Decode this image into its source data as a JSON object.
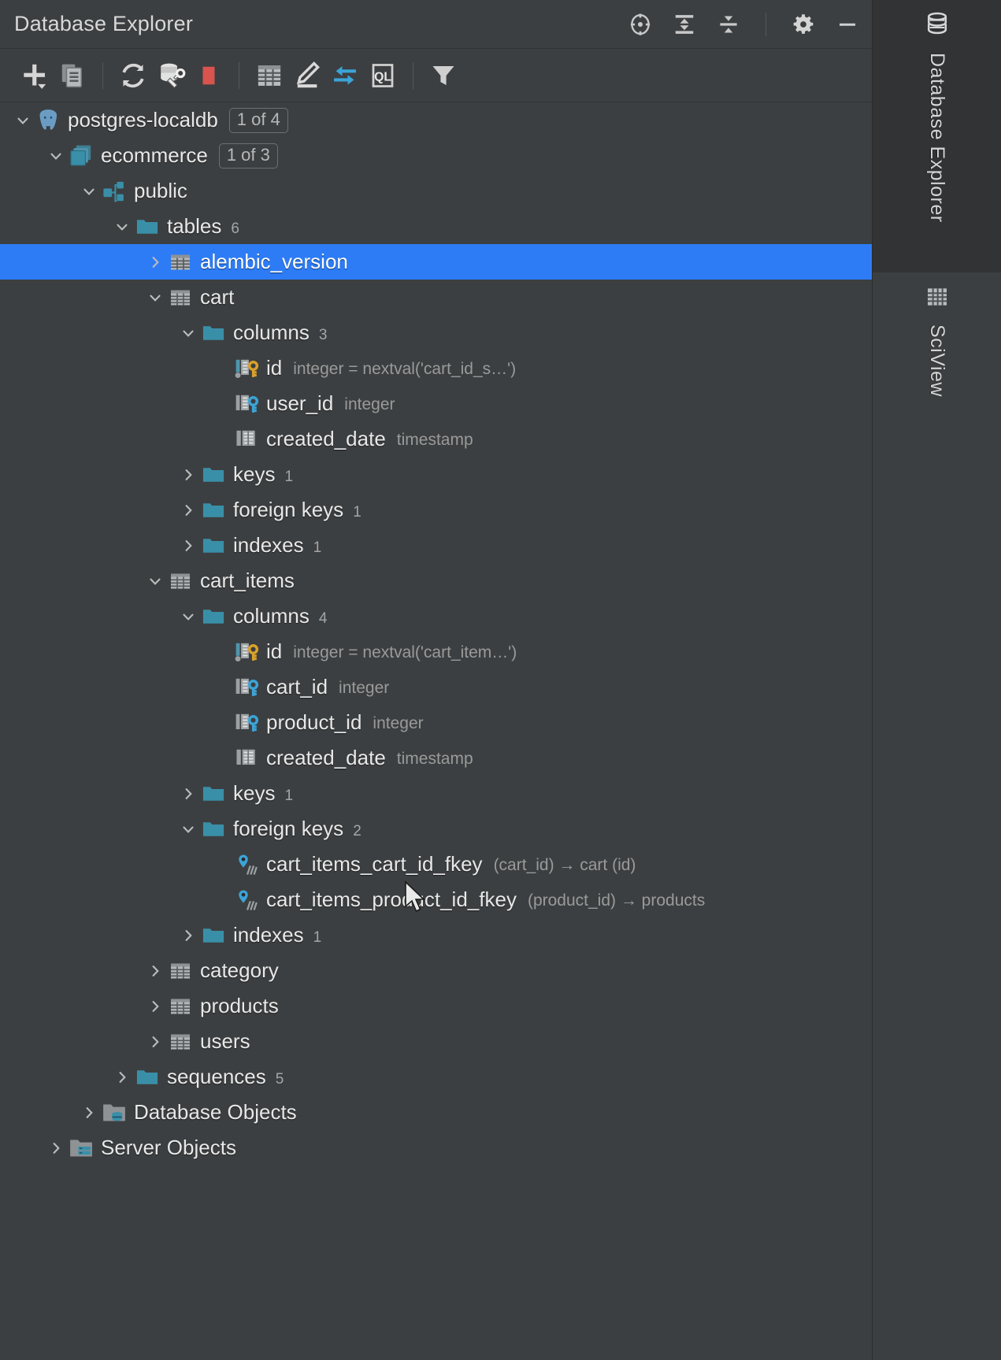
{
  "header": {
    "title": "Database Explorer",
    "icons": [
      {
        "name": "locate-icon",
        "label": "Scroll from Source"
      },
      {
        "name": "expand-all-icon",
        "label": "Expand All"
      },
      {
        "name": "collapse-all-icon",
        "label": "Collapse All"
      },
      {
        "name": "gear-icon",
        "label": "Options"
      },
      {
        "name": "minimize-icon",
        "label": "Hide"
      }
    ]
  },
  "toolbar": {
    "buttons": [
      {
        "name": "add-icon",
        "label": "New"
      },
      {
        "name": "copy-icon",
        "label": "Duplicate"
      },
      {
        "name": "refresh-icon",
        "label": "Refresh"
      },
      {
        "name": "db-properties-icon",
        "label": "Properties"
      },
      {
        "name": "stop-icon",
        "label": "Stop"
      },
      {
        "name": "table-editor-icon",
        "label": "Open Data Editor"
      },
      {
        "name": "modify-icon",
        "label": "Modify"
      },
      {
        "name": "sync-icon",
        "label": "Synchronize"
      },
      {
        "name": "query-console-icon",
        "label": "Open Query Console"
      },
      {
        "name": "filter-icon",
        "label": "Filter"
      }
    ]
  },
  "tree": [
    {
      "indent": 0,
      "twisty": "down",
      "icon": "postgres-icon",
      "label": "postgres-localdb",
      "badge": "1 of 4"
    },
    {
      "indent": 1,
      "twisty": "down",
      "icon": "database-icon",
      "label": "ecommerce",
      "badge": "1 of 3"
    },
    {
      "indent": 2,
      "twisty": "down",
      "icon": "schema-icon",
      "label": "public"
    },
    {
      "indent": 3,
      "twisty": "down",
      "icon": "folder-icon",
      "label": "tables",
      "count": "6"
    },
    {
      "indent": 4,
      "twisty": "right",
      "icon": "table-icon",
      "label": "alembic_version",
      "selected": true
    },
    {
      "indent": 4,
      "twisty": "down",
      "icon": "table-icon",
      "label": "cart"
    },
    {
      "indent": 5,
      "twisty": "down",
      "icon": "folder-icon",
      "label": "columns",
      "count": "3"
    },
    {
      "indent": 6,
      "twisty": "none",
      "icon": "column-pk-icon",
      "label": "id",
      "type": "integer = nextval('cart_id_s…')"
    },
    {
      "indent": 6,
      "twisty": "none",
      "icon": "column-fk-icon",
      "label": "user_id",
      "type": "integer"
    },
    {
      "indent": 6,
      "twisty": "none",
      "icon": "column-icon",
      "label": "created_date",
      "type": "timestamp"
    },
    {
      "indent": 5,
      "twisty": "right",
      "icon": "folder-icon",
      "label": "keys",
      "count": "1"
    },
    {
      "indent": 5,
      "twisty": "right",
      "icon": "folder-icon",
      "label": "foreign keys",
      "count": "1"
    },
    {
      "indent": 5,
      "twisty": "right",
      "icon": "folder-icon",
      "label": "indexes",
      "count": "1"
    },
    {
      "indent": 4,
      "twisty": "down",
      "icon": "table-icon",
      "label": "cart_items"
    },
    {
      "indent": 5,
      "twisty": "down",
      "icon": "folder-icon",
      "label": "columns",
      "count": "4"
    },
    {
      "indent": 6,
      "twisty": "none",
      "icon": "column-pk-icon",
      "label": "id",
      "type": "integer = nextval('cart_item…')"
    },
    {
      "indent": 6,
      "twisty": "none",
      "icon": "column-fk-icon",
      "label": "cart_id",
      "type": "integer"
    },
    {
      "indent": 6,
      "twisty": "none",
      "icon": "column-fk-icon",
      "label": "product_id",
      "type": "integer"
    },
    {
      "indent": 6,
      "twisty": "none",
      "icon": "column-icon",
      "label": "created_date",
      "type": "timestamp"
    },
    {
      "indent": 5,
      "twisty": "right",
      "icon": "folder-icon",
      "label": "keys",
      "count": "1"
    },
    {
      "indent": 5,
      "twisty": "down",
      "icon": "folder-icon",
      "label": "foreign keys",
      "count": "2"
    },
    {
      "indent": 6,
      "twisty": "none",
      "icon": "foreign-key-icon",
      "label": "cart_items_cart_id_fkey",
      "type": "(cart_id) → cart (id)"
    },
    {
      "indent": 6,
      "twisty": "none",
      "icon": "foreign-key-icon",
      "label": "cart_items_product_id_fkey",
      "type": "(product_id) → products"
    },
    {
      "indent": 5,
      "twisty": "right",
      "icon": "folder-icon",
      "label": "indexes",
      "count": "1"
    },
    {
      "indent": 4,
      "twisty": "right",
      "icon": "table-icon",
      "label": "category"
    },
    {
      "indent": 4,
      "twisty": "right",
      "icon": "table-icon",
      "label": "products"
    },
    {
      "indent": 4,
      "twisty": "right",
      "icon": "table-icon",
      "label": "users"
    },
    {
      "indent": 3,
      "twisty": "right",
      "icon": "folder-icon",
      "label": "sequences",
      "count": "5"
    },
    {
      "indent": 2,
      "twisty": "right",
      "icon": "database-objects-icon",
      "label": "Database Objects"
    },
    {
      "indent": 1,
      "twisty": "right",
      "icon": "server-objects-icon",
      "label": "Server Objects"
    }
  ],
  "sidebar": {
    "tabs": [
      {
        "label": "Database Explorer",
        "icon": "database-stack-icon",
        "active": true
      },
      {
        "label": "SciView",
        "icon": "grid-table-icon",
        "active": false
      }
    ]
  },
  "colors": {
    "selection": "#2d7cf6",
    "accent_teal": "#3a8fa8",
    "pk_gold": "#d9a12b",
    "fk_blue": "#3ba4d8",
    "stop_red": "#d9534f",
    "panel_bg": "#3c3f41"
  }
}
